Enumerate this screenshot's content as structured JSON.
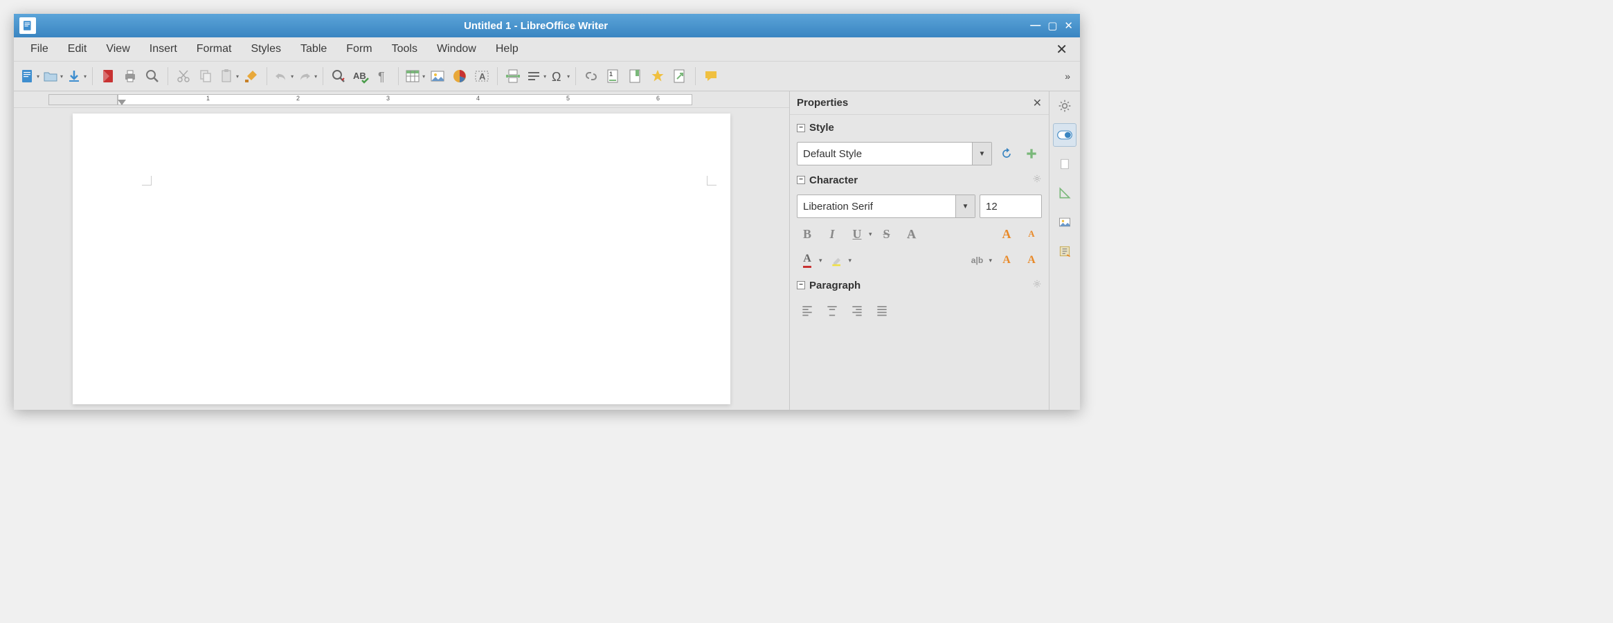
{
  "window": {
    "title": "Untitled 1 - LibreOffice Writer"
  },
  "menubar": {
    "items": [
      "File",
      "Edit",
      "View",
      "Insert",
      "Format",
      "Styles",
      "Table",
      "Form",
      "Tools",
      "Window",
      "Help"
    ]
  },
  "toolbar": {
    "items": [
      {
        "name": "new-doc",
        "dd": true
      },
      {
        "name": "open",
        "dd": true
      },
      {
        "name": "save",
        "dd": true
      },
      {
        "sep": true
      },
      {
        "name": "export-pdf"
      },
      {
        "name": "print"
      },
      {
        "name": "print-preview"
      },
      {
        "sep": true
      },
      {
        "name": "cut"
      },
      {
        "name": "copy"
      },
      {
        "name": "paste",
        "dd": true
      },
      {
        "name": "clone-formatting"
      },
      {
        "sep": true
      },
      {
        "name": "undo",
        "dd": true
      },
      {
        "name": "redo",
        "dd": true
      },
      {
        "sep": true
      },
      {
        "name": "find-replace"
      },
      {
        "name": "spellcheck"
      },
      {
        "name": "formatting-marks"
      },
      {
        "sep": true
      },
      {
        "name": "insert-table",
        "dd": true
      },
      {
        "name": "insert-image"
      },
      {
        "name": "insert-chart"
      },
      {
        "name": "insert-textbox"
      },
      {
        "sep": true
      },
      {
        "name": "insert-page-break"
      },
      {
        "name": "insert-field",
        "dd": true
      },
      {
        "name": "insert-special-char",
        "dd": true
      },
      {
        "sep": true
      },
      {
        "name": "insert-hyperlink"
      },
      {
        "name": "insert-footnote"
      },
      {
        "name": "insert-bookmark"
      },
      {
        "name": "insert-cross-ref"
      },
      {
        "name": "insert-comment-box"
      },
      {
        "sep": true
      },
      {
        "name": "insert-comment"
      }
    ]
  },
  "ruler": {
    "marks": [
      1,
      2,
      3,
      4,
      5,
      6
    ]
  },
  "sidebar": {
    "title": "Properties",
    "style_section": {
      "title": "Style",
      "value": "Default Style"
    },
    "character_section": {
      "title": "Character",
      "font": "Liberation Serif",
      "size": "12"
    },
    "paragraph_section": {
      "title": "Paragraph"
    }
  }
}
